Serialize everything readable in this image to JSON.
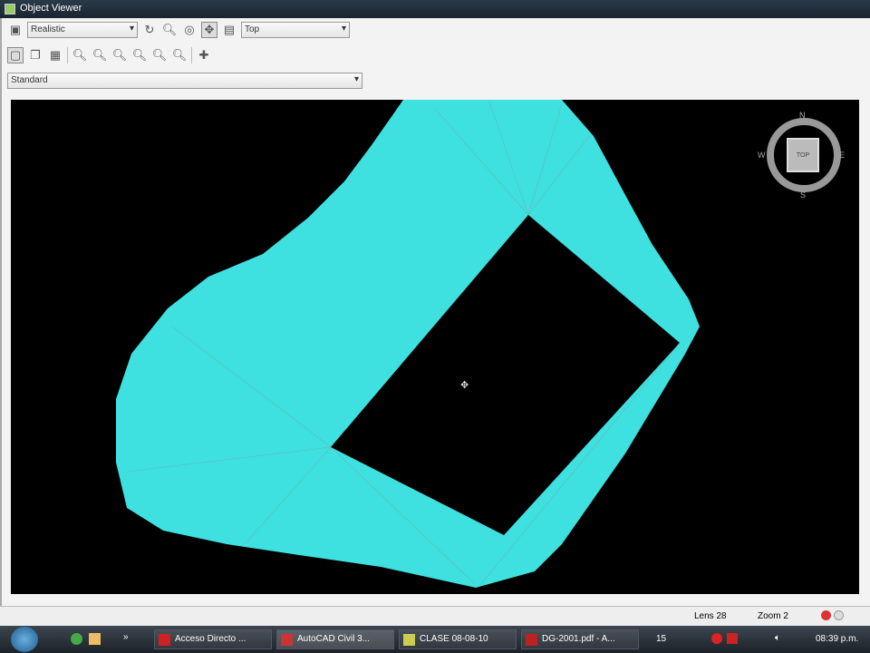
{
  "window": {
    "title": "Object Viewer"
  },
  "toolbar": {
    "visual_style": "Realistic",
    "view": "Top",
    "view_style": "Standard"
  },
  "viewcube": {
    "face": "TOP",
    "north": "N",
    "south": "S",
    "east": "E",
    "west": "W"
  },
  "status": {
    "lens": "Lens 28",
    "zoom": "Zoom 2"
  },
  "taskbar": {
    "items": [
      "Acceso Directo ...",
      "AutoCAD Civil 3...",
      "CLASE 08-08-10",
      "DG-2001.pdf - A..."
    ],
    "clock": "08:39 p.m.",
    "tray_number": "15"
  },
  "colors": {
    "surface": "#3fe0e0",
    "background": "#000000"
  }
}
